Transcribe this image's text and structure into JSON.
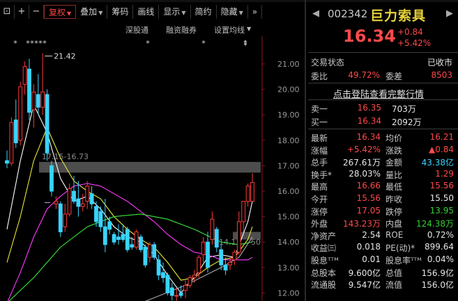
{
  "toolbar": {
    "items": [
      {
        "label": "⊡"
      },
      {
        "label": "+"
      },
      {
        "label": "−"
      },
      {
        "label": "复权",
        "dropdown": true,
        "active": true
      },
      {
        "label": "叠加",
        "dropdown": true
      },
      {
        "label": "筹码"
      },
      {
        "label": "画线"
      },
      {
        "label": "显示",
        "dropdown": true
      },
      {
        "label": "简约"
      },
      {
        "label": "隐藏",
        "dropdown": true
      },
      {
        "label": "»"
      }
    ]
  },
  "subtabs": [
    "深股通",
    "融资融券",
    "设置均线"
  ],
  "chart": {
    "y_ticks": [
      "21.00",
      "20.00",
      "19.00",
      "18.00",
      "17.00",
      "16.00",
      "15.00",
      "14.00",
      "13.00",
      "12.00"
    ],
    "high_marker": "21.42",
    "overlay_label": "17.15-16.73",
    "low_label": "14.1",
    "band_label": "50",
    "event_stars": [
      "*",
      "*",
      "*",
      "*",
      "*",
      "*",
      "*",
      "*",
      "⇞"
    ]
  },
  "chart_data": {
    "type": "candlestick",
    "ylim": [
      11.55,
      21.55
    ],
    "candles": [
      {
        "o": 17.2,
        "h": 17.6,
        "l": 16.9,
        "c": 17.1
      },
      {
        "o": 17.1,
        "h": 18.9,
        "l": 17.0,
        "c": 18.7
      },
      {
        "o": 18.8,
        "h": 19.6,
        "l": 17.7,
        "c": 17.9
      },
      {
        "o": 18.0,
        "h": 20.3,
        "l": 17.8,
        "c": 20.1
      },
      {
        "o": 20.2,
        "h": 21.1,
        "l": 19.8,
        "c": 20.9
      },
      {
        "o": 20.8,
        "h": 21.2,
        "l": 18.8,
        "c": 19.1
      },
      {
        "o": 19.2,
        "h": 20.2,
        "l": 18.5,
        "c": 19.9
      },
      {
        "o": 19.8,
        "h": 20.6,
        "l": 19.0,
        "c": 19.3
      },
      {
        "o": 19.3,
        "h": 21.42,
        "l": 19.0,
        "c": 19.9
      },
      {
        "o": 19.8,
        "h": 20.0,
        "l": 17.2,
        "c": 17.5
      },
      {
        "o": 17.0,
        "h": 17.2,
        "l": 15.8,
        "c": 16.0
      },
      {
        "o": 15.5,
        "h": 15.8,
        "l": 15.3,
        "c": 15.6
      },
      {
        "o": 15.5,
        "h": 15.6,
        "l": 14.2,
        "c": 14.4
      },
      {
        "o": 14.6,
        "h": 15.5,
        "l": 14.4,
        "c": 15.1
      },
      {
        "o": 15.1,
        "h": 16.3,
        "l": 15.0,
        "c": 16.1
      },
      {
        "o": 16.0,
        "h": 16.6,
        "l": 15.5,
        "c": 15.6
      },
      {
        "o": 15.7,
        "h": 16.4,
        "l": 15.0,
        "c": 15.4
      },
      {
        "o": 15.4,
        "h": 15.9,
        "l": 15.2,
        "c": 15.5
      },
      {
        "o": 15.6,
        "h": 16.4,
        "l": 15.3,
        "c": 16.2
      },
      {
        "o": 15.9,
        "h": 16.2,
        "l": 15.3,
        "c": 15.5
      },
      {
        "o": 15.4,
        "h": 15.6,
        "l": 14.6,
        "c": 14.8
      },
      {
        "o": 15.2,
        "h": 15.4,
        "l": 14.4,
        "c": 14.6
      },
      {
        "o": 14.6,
        "h": 15.7,
        "l": 13.6,
        "c": 13.9
      },
      {
        "o": 14.8,
        "h": 15.0,
        "l": 14.3,
        "c": 14.5
      },
      {
        "o": 14.3,
        "h": 14.4,
        "l": 13.9,
        "c": 14.0
      },
      {
        "o": 14.2,
        "h": 14.7,
        "l": 13.9,
        "c": 14.1
      },
      {
        "o": 14.3,
        "h": 14.7,
        "l": 14.0,
        "c": 14.1
      },
      {
        "o": 14.5,
        "h": 14.6,
        "l": 13.6,
        "c": 13.7
      },
      {
        "o": 13.9,
        "h": 14.2,
        "l": 13.7,
        "c": 13.8
      },
      {
        "o": 13.8,
        "h": 14.5,
        "l": 13.7,
        "c": 14.4
      },
      {
        "o": 14.2,
        "h": 14.3,
        "l": 13.6,
        "c": 13.7
      },
      {
        "o": 13.8,
        "h": 13.9,
        "l": 13.0,
        "c": 13.1
      },
      {
        "o": 13.4,
        "h": 14.0,
        "l": 13.2,
        "c": 13.9
      },
      {
        "o": 13.9,
        "h": 14.0,
        "l": 13.3,
        "c": 13.4
      },
      {
        "o": 13.3,
        "h": 13.5,
        "l": 12.5,
        "c": 12.7
      },
      {
        "o": 12.8,
        "h": 13.2,
        "l": 12.4,
        "c": 12.6
      },
      {
        "o": 12.7,
        "h": 12.8,
        "l": 11.9,
        "c": 12.0
      },
      {
        "o": 12.2,
        "h": 12.4,
        "l": 11.7,
        "c": 11.9
      },
      {
        "o": 11.9,
        "h": 12.2,
        "l": 11.6,
        "c": 11.9
      },
      {
        "o": 12.0,
        "h": 12.3,
        "l": 11.8,
        "c": 11.9
      },
      {
        "o": 12.1,
        "h": 12.5,
        "l": 11.8,
        "c": 12.3
      },
      {
        "o": 12.3,
        "h": 12.7,
        "l": 12.2,
        "c": 12.6
      },
      {
        "o": 12.6,
        "h": 12.9,
        "l": 12.4,
        "c": 12.7
      },
      {
        "o": 12.8,
        "h": 13.5,
        "l": 12.6,
        "c": 13.4
      },
      {
        "o": 13.5,
        "h": 14.2,
        "l": 13.2,
        "c": 14.0
      },
      {
        "o": 14.0,
        "h": 14.4,
        "l": 12.8,
        "c": 13.0
      },
      {
        "o": 14.1,
        "h": 15.2,
        "l": 13.9,
        "c": 14.9
      },
      {
        "o": 14.5,
        "h": 14.6,
        "l": 13.6,
        "c": 13.8
      },
      {
        "o": 13.7,
        "h": 13.9,
        "l": 12.9,
        "c": 13.1
      },
      {
        "o": 13.1,
        "h": 13.4,
        "l": 12.7,
        "c": 12.9
      },
      {
        "o": 13.1,
        "h": 13.4,
        "l": 12.9,
        "c": 13.2
      },
      {
        "o": 13.3,
        "h": 13.7,
        "l": 13.1,
        "c": 13.6
      },
      {
        "o": 13.6,
        "h": 15.2,
        "l": 13.5,
        "c": 14.8
      },
      {
        "o": 14.8,
        "h": 15.6,
        "l": 14.4,
        "c": 15.6
      },
      {
        "o": 15.6,
        "h": 16.3,
        "l": 15.4,
        "c": 16.2
      },
      {
        "o": 15.6,
        "h": 16.7,
        "l": 15.6,
        "c": 16.34
      }
    ],
    "ma_lines": [
      {
        "color": "#ffffff",
        "values": [
          [
            0,
            14.5
          ],
          [
            3,
            17.2
          ],
          [
            6,
            19.4
          ],
          [
            9,
            18.3
          ],
          [
            12,
            16.5
          ],
          [
            15,
            15.6
          ],
          [
            18,
            15.8
          ],
          [
            21,
            15.3
          ],
          [
            24,
            14.6
          ],
          [
            27,
            14.2
          ],
          [
            30,
            14.0
          ],
          [
            33,
            13.5
          ],
          [
            36,
            12.7
          ],
          [
            39,
            12.0
          ],
          [
            42,
            12.6
          ],
          [
            45,
            13.4
          ],
          [
            48,
            13.5
          ],
          [
            51,
            13.4
          ],
          [
            54,
            14.8
          ],
          [
            55,
            15.6
          ]
        ]
      },
      {
        "color": "#e8e83a",
        "values": [
          [
            0,
            13.2
          ],
          [
            3,
            15.0
          ],
          [
            6,
            17.2
          ],
          [
            9,
            18.5
          ],
          [
            12,
            17.3
          ],
          [
            15,
            16.4
          ],
          [
            18,
            16.0
          ],
          [
            21,
            15.7
          ],
          [
            24,
            15.0
          ],
          [
            27,
            14.5
          ],
          [
            30,
            14.1
          ],
          [
            33,
            13.8
          ],
          [
            36,
            13.2
          ],
          [
            39,
            12.5
          ],
          [
            42,
            12.6
          ],
          [
            45,
            13.0
          ],
          [
            48,
            13.3
          ],
          [
            51,
            13.4
          ],
          [
            54,
            14.1
          ],
          [
            55,
            14.6
          ]
        ]
      },
      {
        "color": "#ff3aff",
        "values": [
          [
            0,
            11.6
          ],
          [
            3,
            12.8
          ],
          [
            6,
            14.2
          ],
          [
            9,
            15.3
          ],
          [
            12,
            15.8
          ],
          [
            15,
            16.2
          ],
          [
            18,
            16.3
          ],
          [
            21,
            16.2
          ],
          [
            24,
            15.9
          ],
          [
            27,
            15.6
          ],
          [
            30,
            15.2
          ],
          [
            33,
            14.8
          ],
          [
            36,
            14.3
          ],
          [
            39,
            13.9
          ],
          [
            42,
            13.6
          ],
          [
            45,
            13.5
          ],
          [
            48,
            13.3
          ],
          [
            51,
            13.3
          ],
          [
            54,
            13.3
          ],
          [
            55,
            13.4
          ]
        ]
      },
      {
        "color": "#3ae83a",
        "values": [
          [
            0,
            11.6
          ],
          [
            6,
            12.6
          ],
          [
            12,
            13.8
          ],
          [
            18,
            14.6
          ],
          [
            24,
            15.0
          ],
          [
            30,
            15.1
          ],
          [
            36,
            14.9
          ],
          [
            42,
            14.5
          ],
          [
            48,
            14.0
          ],
          [
            52,
            13.9
          ],
          [
            55,
            14.0
          ]
        ]
      },
      {
        "color": "#aaaaaa",
        "values": [
          [
            30,
            11.6
          ],
          [
            40,
            12.3
          ],
          [
            48,
            13.0
          ],
          [
            52,
            13.4
          ],
          [
            55,
            14.2
          ]
        ]
      }
    ]
  },
  "quote": {
    "code": "002342",
    "name": "巨力索具",
    "price": "16.34",
    "change": "+0.84",
    "change_pct": "+5.42%",
    "status_label": "交易状态",
    "status_value": "已收市",
    "weibi_label": "委比",
    "weibi_value": "49.72%",
    "weicha_label": "委差",
    "weicha_value": "8503",
    "login_link": "点击登陆查看完整行情",
    "ask_label": "卖一",
    "ask_price": "16.35",
    "ask_vol": "703万",
    "bid_label": "买一",
    "bid_price": "16.34",
    "bid_vol": "2092万"
  },
  "stats": [
    {
      "l1": "最新",
      "v1": "16.34",
      "c1": "red",
      "l2": "均价",
      "v2": "16.21",
      "c2": "red"
    },
    {
      "l1": "涨幅",
      "v1": "+5.42%",
      "c1": "red",
      "l2": "涨跌",
      "v2": "▲0.84",
      "c2": "red"
    },
    {
      "l1": "总手",
      "v1": "267.61万",
      "c1": "white",
      "l2": "金额",
      "v2": "43.38亿",
      "c2": "cyan"
    },
    {
      "l1": "换手*",
      "v1": "28.03%",
      "c1": "white",
      "l2": "量比",
      "v2": "1.29",
      "c2": "red"
    },
    {
      "l1": "最高",
      "v1": "16.66",
      "c1": "red",
      "l2": "最低",
      "v2": "15.56",
      "c2": "red"
    },
    {
      "l1": "今开",
      "v1": "15.56",
      "c1": "red",
      "l2": "昨收",
      "v2": "15.50",
      "c2": "white"
    },
    {
      "l1": "涨停",
      "v1": "17.05",
      "c1": "red",
      "l2": "跌停",
      "v2": "13.95",
      "c2": "green"
    },
    {
      "l1": "外盘",
      "v1": "143.23万",
      "c1": "red",
      "l2": "内盘",
      "v2": "124.38万",
      "c2": "green"
    },
    {
      "l1": "净资产",
      "v1": "2.54",
      "c1": "white",
      "l2": "ROE",
      "v2": "0.72%",
      "c2": "white"
    },
    {
      "l1": "收益㈢",
      "v1": "0.018",
      "c1": "white",
      "l2": "PE(动)*",
      "v2": "899.64",
      "c2": "white"
    },
    {
      "l1": "股息ᵀᵀᴹ",
      "v1": "0.01",
      "c1": "white",
      "l2": "股息率ᵀᵀᴹ",
      "v2": "0.04%",
      "c2": "white"
    },
    {
      "l1": "总股本",
      "v1": "9.600亿",
      "c1": "white",
      "l2": "总值",
      "v2": "156.9亿",
      "c2": "white"
    },
    {
      "l1": "流通股",
      "v1": "9.547亿",
      "c1": "white",
      "l2": "流值",
      "v2": "156.0亿",
      "c2": "white"
    }
  ],
  "colors": {
    "up": "#ff3a3a",
    "down": "#39d4ff",
    "name": "#e8d23a"
  }
}
